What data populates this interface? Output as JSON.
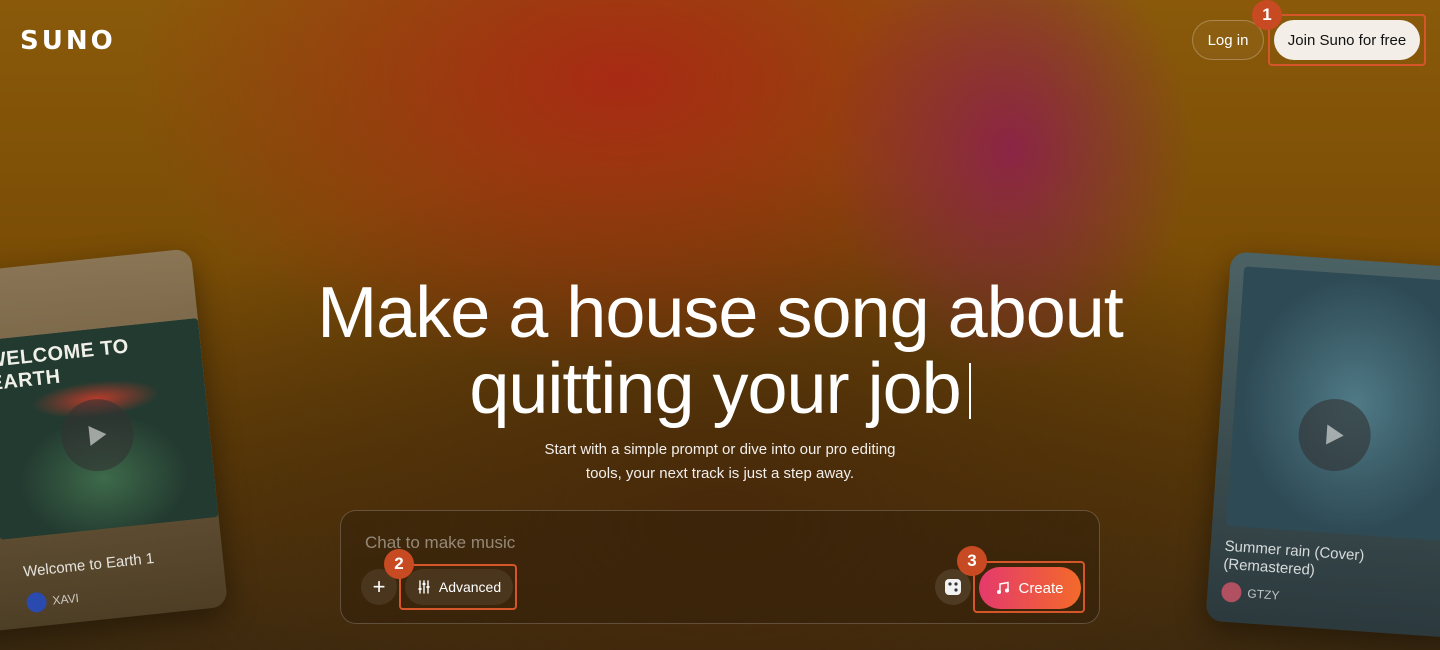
{
  "header": {
    "logo": "SUNO",
    "login_label": "Log in",
    "join_label": "Join Suno for free"
  },
  "hero": {
    "headline_line1": "Make a house song about",
    "headline_line2": "quitting your job",
    "subtitle_line1": "Start with a simple prompt or dive into our pro editing",
    "subtitle_line2": "tools, your next track is just a step away."
  },
  "composer": {
    "placeholder": "Chat to make music",
    "plus_label": "+",
    "advanced_label": "Advanced",
    "create_label": "Create"
  },
  "cards": {
    "left": {
      "art_text": "WELCOME TO EARTH",
      "title": "Welcome to Earth 1",
      "artist": "XAVI"
    },
    "right": {
      "title": "Summer rain (Cover) (Remastered)",
      "artist": "GTZY"
    }
  },
  "annotations": [
    "1",
    "2",
    "3"
  ],
  "colors": {
    "annotation": "#d4562a",
    "create_gradient_start": "#e43a6c",
    "create_gradient_end": "#f36a2a"
  }
}
